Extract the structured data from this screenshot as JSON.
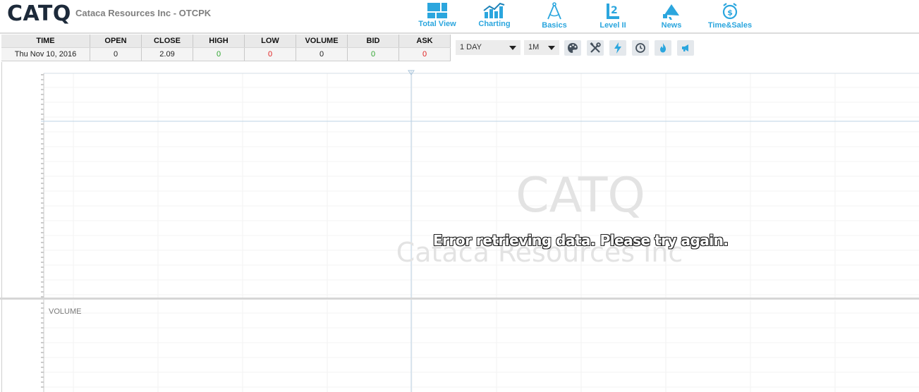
{
  "header": {
    "symbol": "CATQ",
    "company": "Cataca Resources Inc - OTCPK"
  },
  "nav": [
    {
      "label": "Total View",
      "icon": "total-view-icon"
    },
    {
      "label": "Charting",
      "icon": "charting-icon"
    },
    {
      "label": "Basics",
      "icon": "compass-icon"
    },
    {
      "label": "Level II",
      "icon": "level-two-icon"
    },
    {
      "label": "News",
      "icon": "megaphone-icon"
    },
    {
      "label": "Time&Sales",
      "icon": "alarm-clock-dollar-icon"
    }
  ],
  "quote": {
    "headers": [
      "TIME",
      "OPEN",
      "CLOSE",
      "HIGH",
      "LOW",
      "VOLUME",
      "BID",
      "ASK"
    ],
    "values": [
      "Thu Nov 10, 2016",
      "0",
      "2.09",
      "0",
      "0",
      "0",
      "0",
      "0"
    ]
  },
  "controls": {
    "interval": "1 DAY",
    "range": "1M"
  },
  "tools": [
    "palette-icon",
    "tools-icon",
    "lightning-icon",
    "clock-icon",
    "flame-icon",
    "announce-icon"
  ],
  "chart": {
    "watermark_symbol": "CATQ",
    "watermark_company": "Cataca Resources Inc",
    "error": "Error retrieving data. Please try again.",
    "volume_label": "VOLUME"
  },
  "colors": {
    "accent": "#2ba6de",
    "up": "#2fa52f",
    "down": "#e02020",
    "ticker": "#1d2a3a"
  }
}
